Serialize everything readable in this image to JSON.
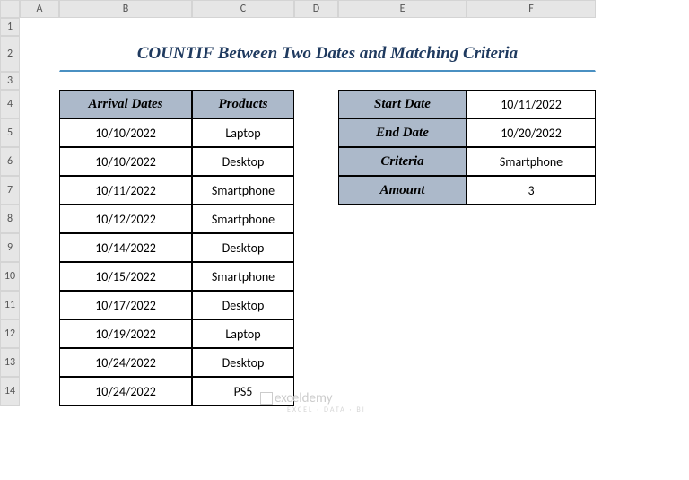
{
  "columns": [
    "A",
    "B",
    "C",
    "D",
    "E",
    "F"
  ],
  "rows": [
    "1",
    "2",
    "3",
    "4",
    "5",
    "6",
    "7",
    "8",
    "9",
    "10",
    "11",
    "12",
    "13",
    "14"
  ],
  "title": "COUNTIF Between Two Dates and Matching Criteria",
  "table1": {
    "headers": {
      "b": "Arrival Dates",
      "c": "Products"
    },
    "data": [
      {
        "b": "10/10/2022",
        "c": "Laptop"
      },
      {
        "b": "10/10/2022",
        "c": "Desktop"
      },
      {
        "b": "10/11/2022",
        "c": "Smartphone"
      },
      {
        "b": "10/12/2022",
        "c": "Smartphone"
      },
      {
        "b": "10/14/2022",
        "c": "Desktop"
      },
      {
        "b": "10/15/2022",
        "c": "Smartphone"
      },
      {
        "b": "10/17/2022",
        "c": "Desktop"
      },
      {
        "b": "10/19/2022",
        "c": "Laptop"
      },
      {
        "b": "10/24/2022",
        "c": "Desktop"
      },
      {
        "b": "10/24/2022",
        "c": "PS5"
      }
    ]
  },
  "table2": {
    "rows": [
      {
        "label": "Start Date",
        "value": "10/11/2022"
      },
      {
        "label": "End Date",
        "value": "10/20/2022"
      },
      {
        "label": "Criteria",
        "value": "Smartphone"
      },
      {
        "label": "Amount",
        "value": "3"
      }
    ]
  },
  "watermark": {
    "text": "exceldemy",
    "sub": "EXCEL · DATA · BI"
  }
}
